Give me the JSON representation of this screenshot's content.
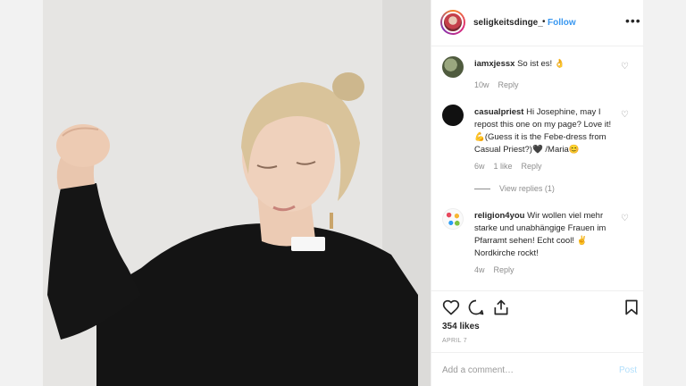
{
  "post": {
    "username": "seligkeitsdinge_",
    "separator": "•",
    "follow_label": "Follow",
    "more_label": "•••"
  },
  "photo": {
    "description_icon": "portrait-photo"
  },
  "comments": [
    {
      "username": "iamxjessx",
      "text": "So ist es! 👌",
      "age": "10w",
      "likes": "",
      "reply_label": "Reply",
      "avatar_color": "#6d7a5c"
    },
    {
      "username": "casualpriest",
      "text": "Hi Josephine, may I repost this one on my page? Love it! 💪(Guess it is the Febe-dress from Casual Priest?)🖤 /Maria😊",
      "age": "6w",
      "likes": "1 like",
      "reply_label": "Reply",
      "view_replies": "View replies (1)",
      "avatar_color": "#111111"
    },
    {
      "username": "religion4you",
      "text": "Wir wollen viel mehr starke und unabhängige Frauen im Pfarramt sehen! Echt cool! ✌ Nordkirche rockt!",
      "age": "4w",
      "likes": "",
      "reply_label": "Reply",
      "avatar_color": "#ffffff"
    }
  ],
  "actions": {
    "likes": "354 likes",
    "date": "APRIL 7"
  },
  "composer": {
    "placeholder": "Add a comment…",
    "post_label": "Post"
  },
  "colors": {
    "link": "#3897f0",
    "text": "#262626",
    "muted": "#8e8e8e",
    "post_disabled": "#b2dffc"
  }
}
